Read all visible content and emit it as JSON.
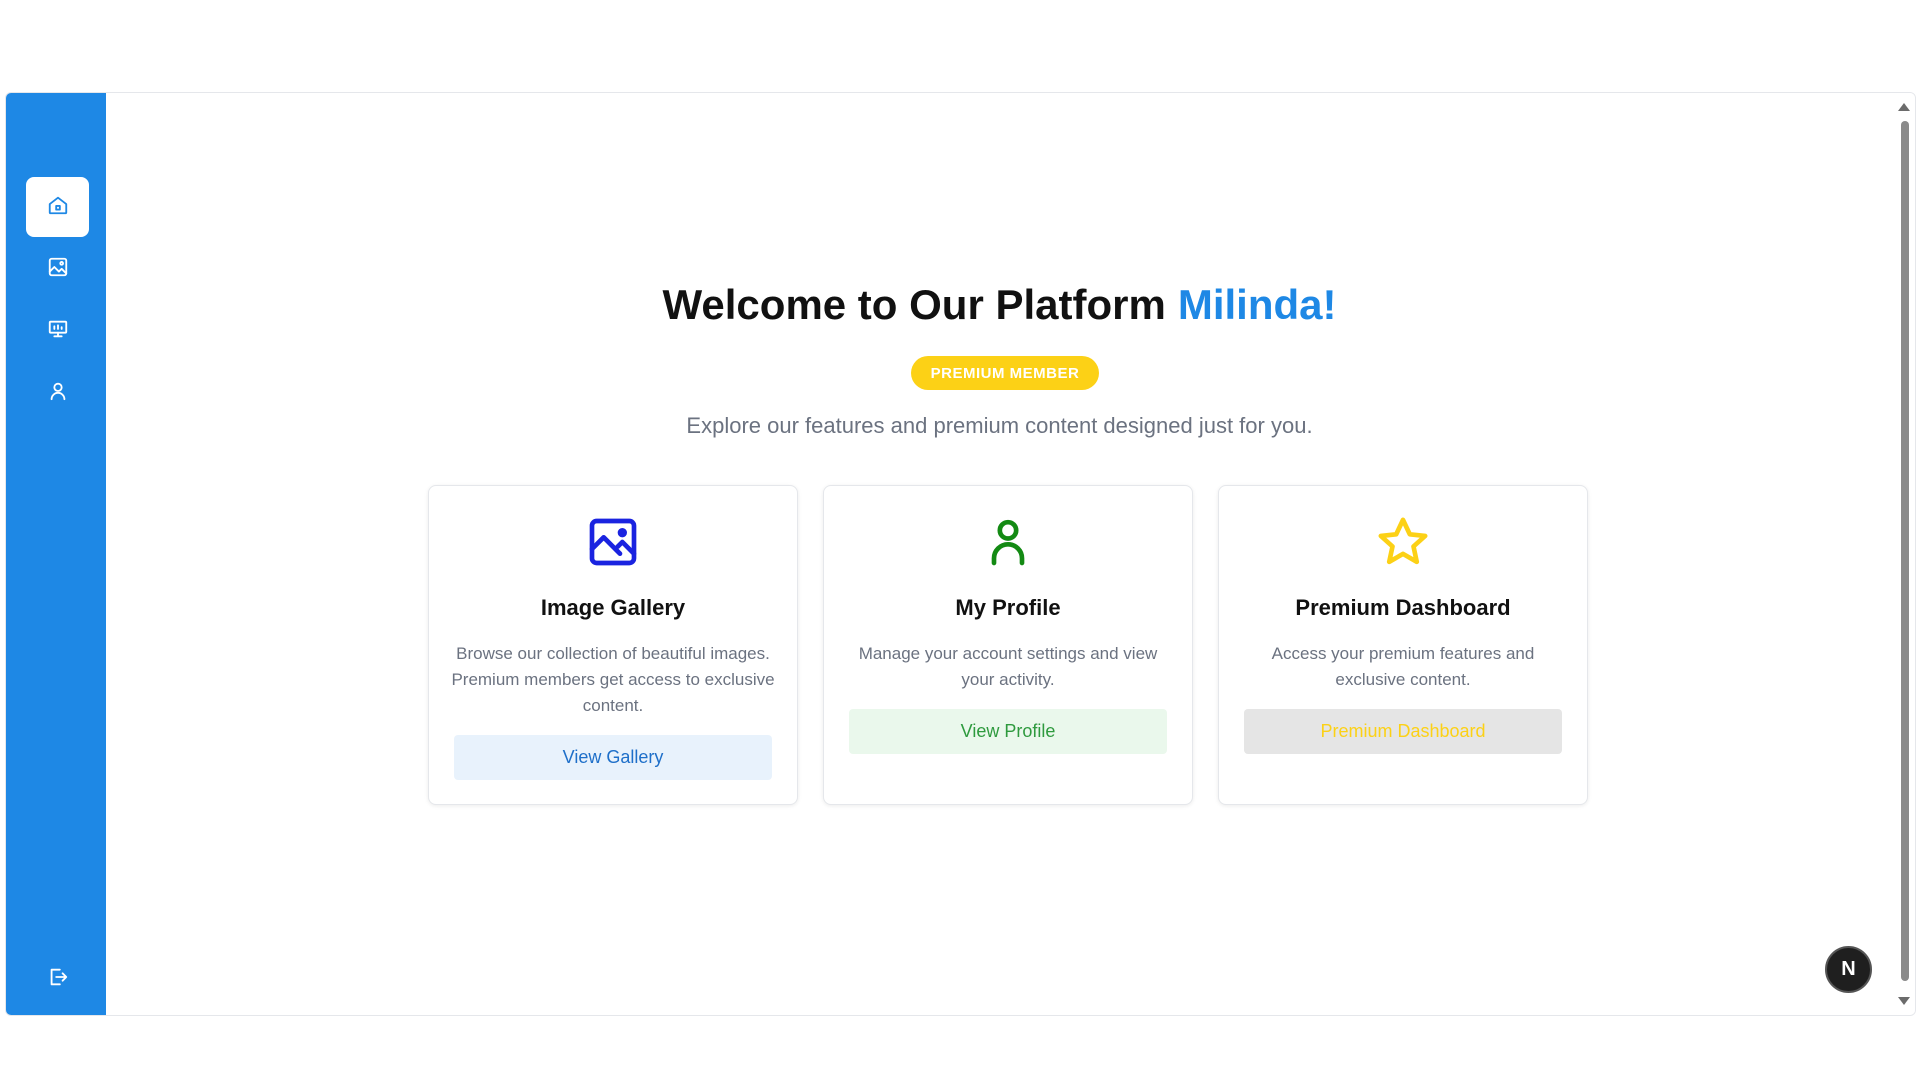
{
  "sidebar": {
    "items": [
      {
        "icon": "home-icon",
        "active": true
      },
      {
        "icon": "image-icon",
        "active": false
      },
      {
        "icon": "presentation-icon",
        "active": false
      },
      {
        "icon": "user-icon",
        "active": false
      }
    ],
    "logout_icon": "logout-icon"
  },
  "header": {
    "title": "Welcome to Our Platform",
    "user_name": "Milinda!",
    "badge": "PREMIUM MEMBER",
    "subtitle": "Explore our features and premium content designed just for you."
  },
  "cards": [
    {
      "icon": "image-icon",
      "title": "Image Gallery",
      "description": "Browse our collection of beautiful images. Premium members get access to exclusive content.",
      "button": "View Gallery"
    },
    {
      "icon": "user-icon",
      "title": "My Profile",
      "description": "Manage your account settings and view your activity.",
      "button": "View Profile"
    },
    {
      "icon": "star-icon",
      "title": "Premium Dashboard",
      "description": "Access your premium features and exclusive content.",
      "button": "Premium Dashboard"
    }
  ],
  "colors": {
    "brand_blue": "#1e88e5",
    "premium_yellow": "#fcd116",
    "profile_green": "#138a13",
    "gallery_blue": "#1a23e0"
  },
  "dev_badge": "N"
}
